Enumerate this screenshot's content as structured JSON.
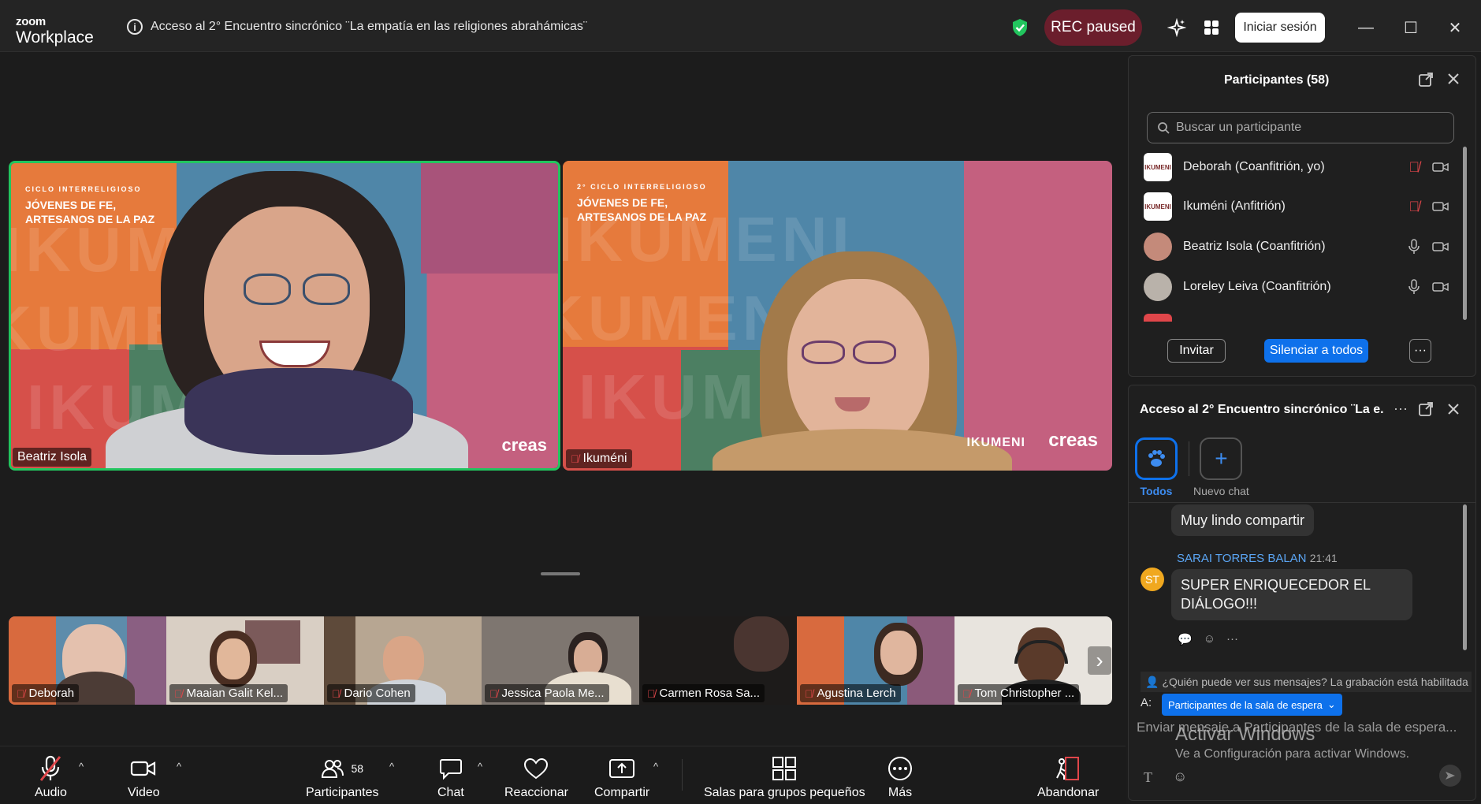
{
  "app": {
    "logo_line1": "zoom",
    "logo_line2": "Workplace"
  },
  "meeting": {
    "title": "Acceso al 2° Encuentro sincrónico ¨La empatía en las religiones abrahámicas¨"
  },
  "titlebar": {
    "rec_label": "REC paused",
    "signin_label": "Iniciar sesión",
    "min": "—",
    "max": "☐",
    "close": "✕"
  },
  "stage": {
    "tiles": [
      {
        "name": "Beatriz Isola",
        "poster_small": "CICLO INTERRELIGIOSO",
        "poster_title": "JÓVENES DE FE, ARTESANOS DE LA PAZ",
        "watermark": "IKUMENI",
        "brand": "creas"
      },
      {
        "name": "Ikuméni",
        "poster_small": "2° CICLO INTERRELIGIOSO",
        "poster_title": "JÓVENES DE FE, ARTESANOS DE LA PAZ",
        "watermark": "IKUMENI",
        "brand": "creas",
        "brand2": "IKUMENI"
      }
    ]
  },
  "strip": {
    "thumbs": [
      {
        "name": "Deborah"
      },
      {
        "name": "Maaian Galit Kel..."
      },
      {
        "name": "Dario Cohen"
      },
      {
        "name": "Jessica Paola Me..."
      },
      {
        "name": "Carmen Rosa Sa..."
      },
      {
        "name": "Agustina Lerch"
      },
      {
        "name": "Tom Christopher ..."
      }
    ]
  },
  "toolbar": {
    "audio": "Audio",
    "video": "Video",
    "participants": "Participantes",
    "participants_count": "58",
    "chat": "Chat",
    "react": "Reaccionar",
    "share": "Compartir",
    "breakout": "Salas para grupos pequeños",
    "more": "Más",
    "leave": "Abandonar"
  },
  "participants_panel": {
    "title": "Participantes (58)",
    "search_placeholder": "Buscar un participante",
    "rows": [
      {
        "name": "Deborah (Coanfitrión, yo)",
        "mic": "muted"
      },
      {
        "name": "Ikuméni (Anfitrión)",
        "mic": "muted"
      },
      {
        "name": "Beatriz Isola (Coanfitrión)",
        "mic": "on"
      },
      {
        "name": "Loreley Leiva (Coanfitrión)",
        "mic": "on"
      }
    ],
    "invite": "Invitar",
    "mute_all": "Silenciar a todos",
    "more": "···"
  },
  "chat_panel": {
    "title": "Acceso al 2° Encuentro sincrónico ¨La e...",
    "tabs": [
      {
        "label": "Todos"
      },
      {
        "label": "Nuevo chat"
      }
    ],
    "messages": [
      {
        "text": "Muy lindo compartir"
      },
      {
        "sender": "SARAI TORRES BALAN",
        "time": "21:41",
        "initials": "ST",
        "text": "SUPER ENRIQUECEDOR EL DIÁLOGO!!!"
      }
    ],
    "notice": "¿Quién puede ver sus mensajes? La grabación está habilitada",
    "to_label": "A:",
    "to_value": "Participantes de la sala de espera",
    "composer_placeholder": "Enviar mensaje a Participantes de la sala de espera..."
  },
  "os_overlay": {
    "line1": "Activar Windows",
    "line2": "Ve a Configuración para activar Windows."
  },
  "colors": {
    "accent": "#0e71eb",
    "active_speaker": "#22c55e",
    "rec_bg": "#6b1e2c",
    "muted": "#e0464a"
  }
}
